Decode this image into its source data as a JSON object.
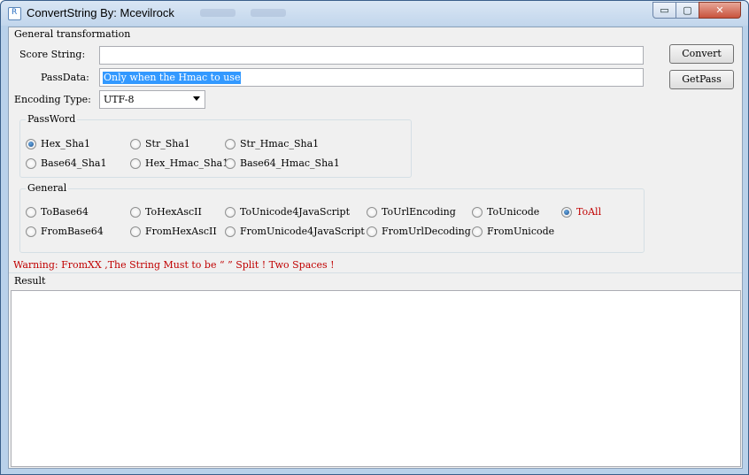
{
  "window": {
    "title": "ConvertString By: Mcevilrock",
    "min_glyph": "▭",
    "max_glyph": "▢",
    "close_glyph": "✕"
  },
  "form": {
    "section_label": "General transformation",
    "score_label": "Score String:",
    "score_value": "",
    "passdata_label": "PassData:",
    "passdata_value": "Only when the Hmac to use",
    "encoding_label": "Encoding Type:",
    "encoding_value": "UTF-8"
  },
  "buttons": {
    "convert": "Convert",
    "getpass": "GetPass"
  },
  "password_group": {
    "title": "PassWord",
    "options": [
      "Hex_Sha1",
      "Str_Sha1",
      "Str_Hmac_Sha1",
      "Base64_Sha1",
      "Hex_Hmac_Sha1",
      "Base64_Hmac_Sha1"
    ],
    "selected": "Hex_Sha1"
  },
  "general_group": {
    "title": "General",
    "options": [
      "ToBase64",
      "ToHexAscII",
      "ToUnicode4JavaScript",
      "ToUrlEncoding",
      "ToUnicode",
      "ToAll",
      "FromBase64",
      "FromHexAscII",
      "FromUnicode4JavaScript",
      "FromUrlDecoding",
      "FromUnicode"
    ],
    "selected": "ToAll"
  },
  "warning": "Warning:  FromXX ,The String Must to be “  ” Split ! Two Spaces !",
  "result": {
    "label": "Result",
    "value": ""
  },
  "colors": {
    "warning": "#c00000",
    "selection": "#3399ff"
  }
}
